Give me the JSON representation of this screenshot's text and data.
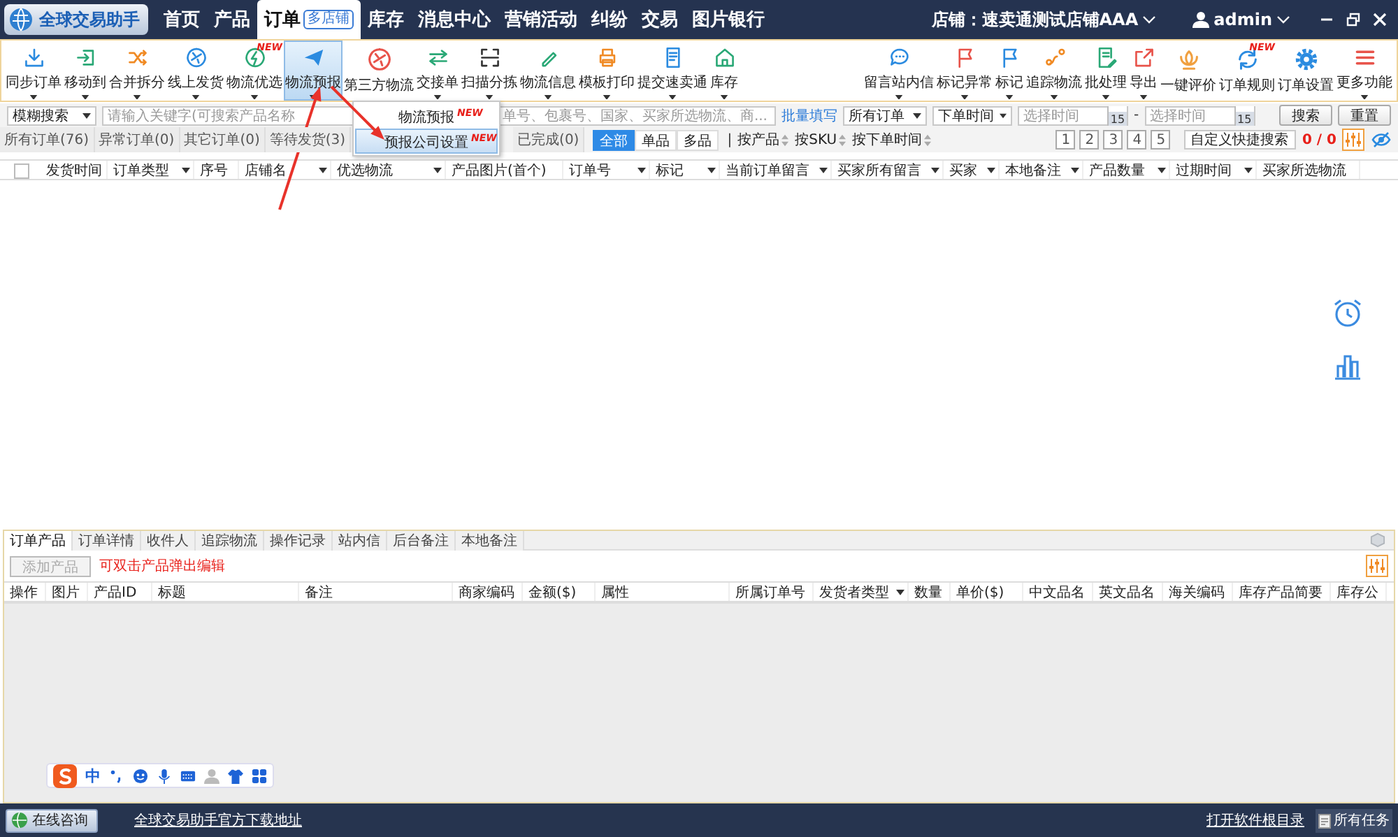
{
  "app": {
    "title": "全球交易助手"
  },
  "nav": [
    {
      "label": "首页",
      "selected": false
    },
    {
      "label": "产品",
      "selected": false
    },
    {
      "label": "订单",
      "selected": true,
      "badge": "多店铺"
    },
    {
      "label": "库存",
      "selected": false
    },
    {
      "label": "消息中心",
      "selected": false
    },
    {
      "label": "营销活动",
      "selected": false
    },
    {
      "label": "纠纷",
      "selected": false
    },
    {
      "label": "交易",
      "selected": false
    },
    {
      "label": "图片银行",
      "selected": false
    }
  ],
  "account": {
    "store": "店铺：速卖通测试店铺AAA",
    "user": "admin"
  },
  "toolbar": {
    "left": [
      {
        "label": "同步订单",
        "has_menu": true,
        "selected": false
      },
      {
        "label": "移动到",
        "has_menu": true,
        "selected": false
      },
      {
        "label": "合并拆分",
        "has_menu": true,
        "selected": false
      },
      {
        "label": "线上发货",
        "has_menu": true,
        "selected": false
      },
      {
        "label": "物流优选",
        "has_menu": true,
        "selected": false,
        "badge": "NEW"
      },
      {
        "label": "物流预报",
        "has_menu": true,
        "selected": true
      },
      {
        "label": "第三方物流",
        "has_menu": false,
        "selected": false
      },
      {
        "label": "交接单",
        "has_menu": true,
        "selected": false
      },
      {
        "label": "扫描分拣",
        "has_menu": true,
        "selected": false
      },
      {
        "label": "物流信息",
        "has_menu": true,
        "selected": false
      },
      {
        "label": "模板打印",
        "has_menu": true,
        "selected": false
      },
      {
        "label": "提交速卖通",
        "has_menu": true,
        "selected": false
      },
      {
        "label": "库存",
        "has_menu": true,
        "selected": false
      }
    ],
    "right": [
      {
        "label": "留言站内信",
        "has_menu": true,
        "selected": false
      },
      {
        "label": "标记异常",
        "has_menu": true,
        "selected": false
      },
      {
        "label": "标记",
        "has_menu": true,
        "selected": false
      },
      {
        "label": "追踪物流",
        "has_menu": true,
        "selected": false
      },
      {
        "label": "批处理",
        "has_menu": true,
        "selected": false
      },
      {
        "label": "导出",
        "has_menu": true,
        "selected": false
      },
      {
        "label": "一键评价",
        "has_menu": false,
        "selected": false
      },
      {
        "label": "订单规则",
        "has_menu": false,
        "selected": false,
        "badge": "NEW"
      },
      {
        "label": "订单设置",
        "has_menu": false,
        "selected": false
      },
      {
        "label": "更多功能",
        "has_menu": true,
        "selected": false
      }
    ]
  },
  "dropdown": {
    "items": [
      {
        "label": "物流预报",
        "badge": "NEW",
        "selected": false
      },
      {
        "label": "预报公司设置",
        "badge": "NEW",
        "selected": true
      }
    ]
  },
  "filters": {
    "search_mode": "模糊搜索",
    "keyword_placeholder_start": "请输入关键字(可搜索产品名称",
    "keyword_placeholder_end": "单号、包裹号、国家、买家所选物流、商...",
    "batch_link": "批量填写",
    "order_scope": "所有订单",
    "time_type": "下单时间",
    "date_from": {
      "placeholder": "选择时间",
      "calendar": "15"
    },
    "separator": "-",
    "date_to": {
      "placeholder": "选择时间",
      "calendar": "15"
    },
    "buttons": [
      "搜索",
      "重置"
    ]
  },
  "status_tabs": [
    {
      "label": "所有订单(76)",
      "selected": false
    },
    {
      "label": "异常订单(0)",
      "selected": false
    },
    {
      "label": "其它订单(0)",
      "selected": false
    },
    {
      "label": "等待发货(3)",
      "selected": false
    },
    {
      "label": "已完成(0)",
      "selected": false
    }
  ],
  "item_filter": [
    {
      "label": "全部",
      "selected": true
    },
    {
      "label": "单品",
      "selected": false
    },
    {
      "label": "多品",
      "selected": false
    }
  ],
  "sort_separator": "|",
  "sorts": [
    "按产品",
    "按SKU",
    "按下单时间"
  ],
  "pages": [
    "1",
    "2",
    "3",
    "4",
    "5"
  ],
  "quick_search": "自定义快捷搜索",
  "counter": "0 / 0",
  "table": {
    "select_all": {
      "checked": false
    },
    "columns": [
      {
        "label": "发货时间",
        "has_menu": false
      },
      {
        "label": "订单类型",
        "has_menu": true
      },
      {
        "label": "序号",
        "has_menu": false
      },
      {
        "label": "店铺名",
        "has_menu": true
      },
      {
        "label": "优选物流",
        "has_menu": true
      },
      {
        "label": "产品图片(首个)",
        "has_menu": false
      },
      {
        "label": "订单号",
        "has_menu": true
      },
      {
        "label": "标记",
        "has_menu": true
      },
      {
        "label": "当前订单留言",
        "has_menu": true
      },
      {
        "label": "买家所有留言",
        "has_menu": true
      },
      {
        "label": "买家",
        "has_menu": true
      },
      {
        "label": "本地备注",
        "has_menu": true
      },
      {
        "label": "产品数量",
        "has_menu": true
      },
      {
        "label": "过期时间",
        "has_menu": true
      },
      {
        "label": "买家所选物流",
        "has_menu": false
      }
    ]
  },
  "detail": {
    "tabs": [
      {
        "label": "订单产品",
        "selected": true
      },
      {
        "label": "订单详情",
        "selected": false
      },
      {
        "label": "收件人",
        "selected": false
      },
      {
        "label": "追踪物流",
        "selected": false
      },
      {
        "label": "操作记录",
        "selected": false
      },
      {
        "label": "站内信",
        "selected": false
      },
      {
        "label": "后台备注",
        "selected": false
      },
      {
        "label": "本地备注",
        "selected": false
      }
    ],
    "add_button": {
      "label": "添加产品",
      "disabled": true
    },
    "hint": "可双击产品弹出编辑",
    "columns": [
      {
        "label": "操作",
        "has_menu": false
      },
      {
        "label": "图片",
        "has_menu": false
      },
      {
        "label": "产品ID",
        "has_menu": false
      },
      {
        "label": "标题",
        "has_menu": false
      },
      {
        "label": "备注",
        "has_menu": false
      },
      {
        "label": "商家编码",
        "has_menu": false
      },
      {
        "label": "金额($)",
        "has_menu": false
      },
      {
        "label": "属性",
        "has_menu": false
      },
      {
        "label": "所属订单号",
        "has_menu": false
      },
      {
        "label": "发货者类型",
        "has_menu": true
      },
      {
        "label": "数量",
        "has_menu": false
      },
      {
        "label": "单价($)",
        "has_menu": false
      },
      {
        "label": "中文品名",
        "has_menu": false
      },
      {
        "label": "英文品名",
        "has_menu": false
      },
      {
        "label": "海关编码",
        "has_menu": false
      },
      {
        "label": "库存产品简要",
        "has_menu": false
      },
      {
        "label": "库存公",
        "has_menu": false
      }
    ]
  },
  "ime": {
    "mode": "中"
  },
  "status_bar": {
    "consult": "在线咨询",
    "download_link": "全球交易助手官方下载地址",
    "folder_link": "打开软件根目录",
    "tasks": "所有任务"
  }
}
